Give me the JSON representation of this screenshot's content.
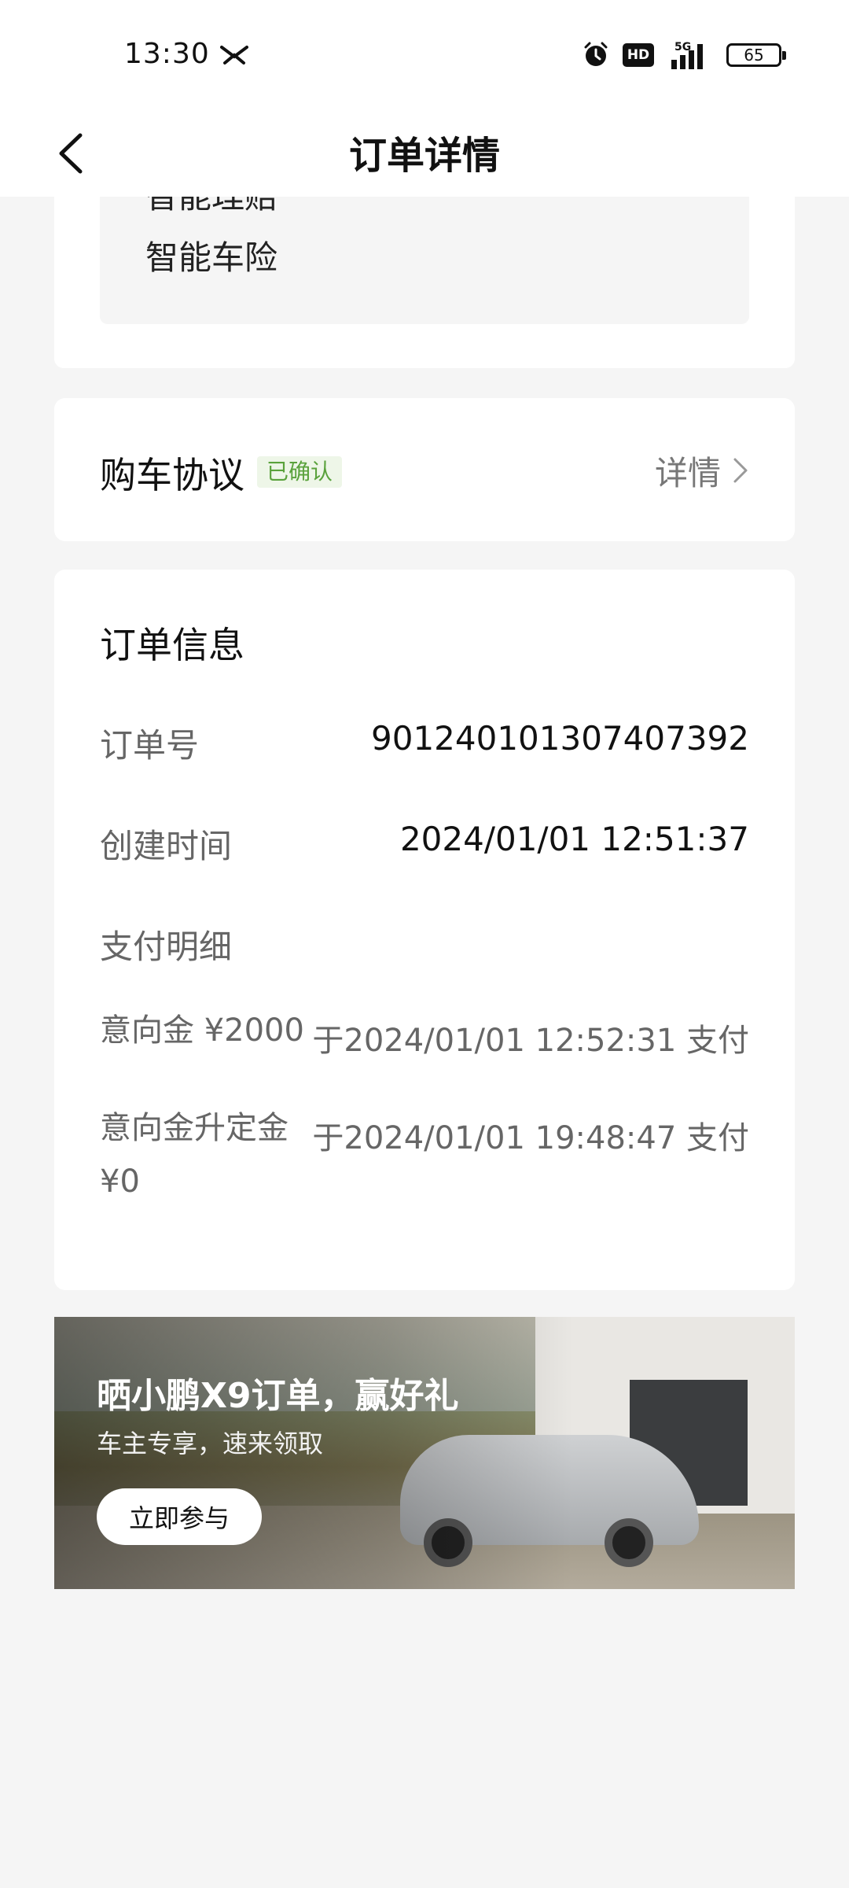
{
  "status_bar": {
    "time": "13:30",
    "hd_label": "HD",
    "network": "5G",
    "battery": "65"
  },
  "nav": {
    "title": "订单详情"
  },
  "services": {
    "previous_item": "智能理赔",
    "item": "智能车险"
  },
  "agreement": {
    "title": "购车协议",
    "status_badge": "已确认",
    "detail_label": "详情"
  },
  "order_info": {
    "title": "订单信息",
    "order_no_label": "订单号",
    "order_no": "901240101307407392",
    "created_label": "创建时间",
    "created_time": "2024/01/01 12:51:37",
    "payment_label": "支付明细",
    "payments": [
      {
        "label": "意向金 ¥2000",
        "value": "于2024/01/01 12:52:31 支付"
      },
      {
        "label": "意向金升定金 ¥0",
        "value": "于2024/01/01 19:48:47 支付"
      }
    ]
  },
  "banner": {
    "title": "晒小鹏X9订单，赢好礼",
    "subtitle": "车主专享，速来领取",
    "button_label": "立即参与"
  },
  "colors": {
    "badge_green": "#5aa23c",
    "badge_bg": "#eef6e8",
    "page_bg": "#f5f5f5"
  }
}
